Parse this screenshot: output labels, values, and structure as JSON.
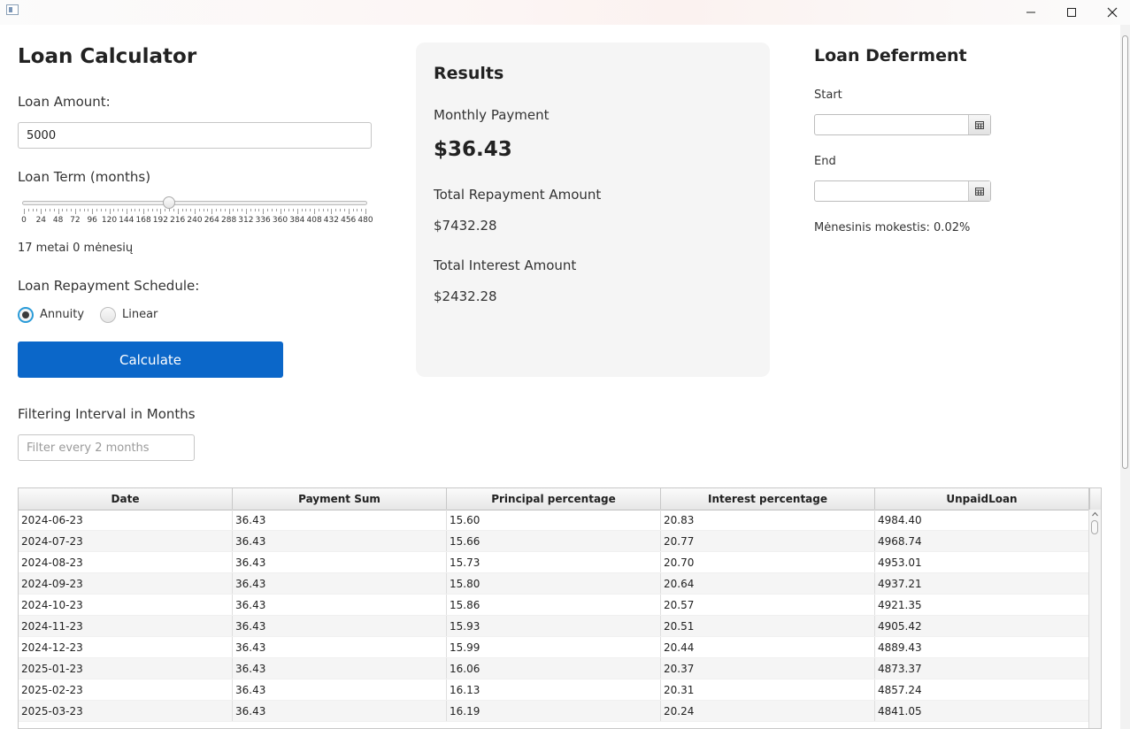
{
  "window": {
    "title": "",
    "icons": [
      "app-icon",
      "minimize-icon",
      "maximize-icon",
      "close-icon"
    ]
  },
  "calculator": {
    "title": "Loan Calculator",
    "loan_amount_label": "Loan Amount:",
    "loan_amount_value": "5000",
    "loan_term_label": "Loan Term (months)",
    "slider": {
      "min": 0,
      "max": 480,
      "value": 204,
      "major_ticks": [
        "0",
        "24",
        "48",
        "72",
        "96",
        "120",
        "144",
        "168",
        "192",
        "216",
        "240",
        "264",
        "288",
        "312",
        "336",
        "360",
        "384",
        "408",
        "432",
        "456",
        "480"
      ]
    },
    "term_text": "17 metai 0 mėnesių",
    "schedule_label": "Loan Repayment Schedule:",
    "schedule_options": [
      {
        "label": "Annuity",
        "selected": true
      },
      {
        "label": "Linear",
        "selected": false
      }
    ],
    "calculate_label": "Calculate",
    "filter_label": "Filtering Interval in Months",
    "filter_placeholder": "Filter every 2 months"
  },
  "results": {
    "title": "Results",
    "monthly_payment_label": "Monthly Payment",
    "monthly_payment_value": "$36.43",
    "total_repayment_label": "Total Repayment Amount",
    "total_repayment_value": "$7432.28",
    "total_interest_label": "Total Interest Amount",
    "total_interest_value": "$2432.28"
  },
  "deferment": {
    "title": "Loan Deferment",
    "start_label": "Start",
    "start_value": "",
    "end_label": "End",
    "end_value": "",
    "fee_text": "Mėnesinis mokestis: 0.02%"
  },
  "table": {
    "columns": [
      "Date",
      "Payment Sum",
      "Principal percentage",
      "Interest percentage",
      "UnpaidLoan"
    ],
    "rows": [
      [
        "2024-06-23",
        "36.43",
        "15.60",
        "20.83",
        "4984.40"
      ],
      [
        "2024-07-23",
        "36.43",
        "15.66",
        "20.77",
        "4968.74"
      ],
      [
        "2024-08-23",
        "36.43",
        "15.73",
        "20.70",
        "4953.01"
      ],
      [
        "2024-09-23",
        "36.43",
        "15.80",
        "20.64",
        "4937.21"
      ],
      [
        "2024-10-23",
        "36.43",
        "15.86",
        "20.57",
        "4921.35"
      ],
      [
        "2024-11-23",
        "36.43",
        "15.93",
        "20.51",
        "4905.42"
      ],
      [
        "2024-12-23",
        "36.43",
        "15.99",
        "20.44",
        "4889.43"
      ],
      [
        "2025-01-23",
        "36.43",
        "16.06",
        "20.37",
        "4873.37"
      ],
      [
        "2025-02-23",
        "36.43",
        "16.13",
        "20.31",
        "4857.24"
      ],
      [
        "2025-03-23",
        "36.43",
        "16.19",
        "20.24",
        "4841.05"
      ]
    ]
  }
}
